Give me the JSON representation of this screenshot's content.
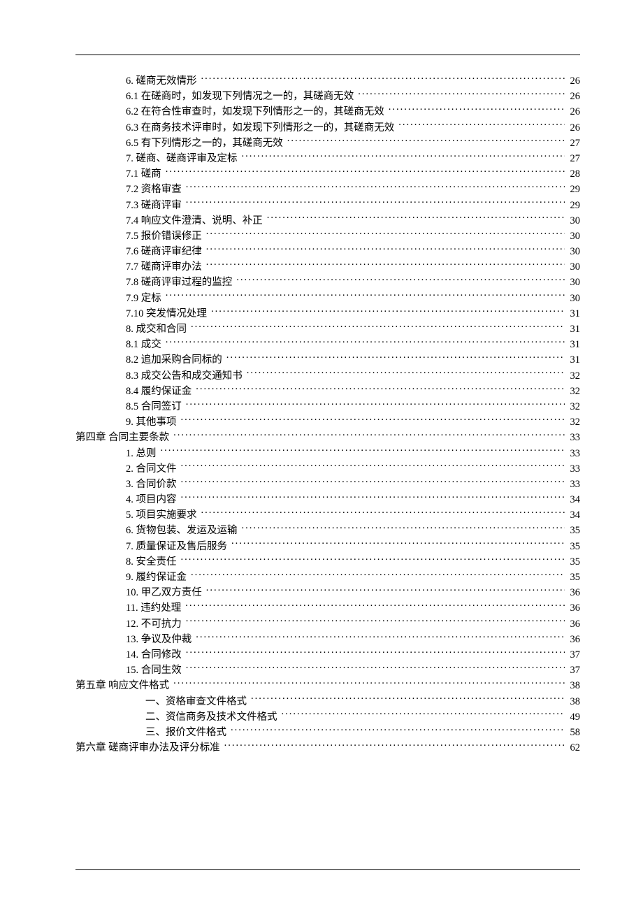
{
  "toc": [
    {
      "indent": 1,
      "label": "6. 磋商无效情形",
      "page": "26"
    },
    {
      "indent": 1,
      "label": "6.1 在磋商时，如发现下列情况之一的，其磋商无效",
      "page": "26"
    },
    {
      "indent": 1,
      "label": "6.2 在符合性审查时，如发现下列情形之一的，其磋商无效",
      "page": "26"
    },
    {
      "indent": 1,
      "label": "6.3 在商务技术评审时，如发现下列情形之一的，其磋商无效",
      "page": "26"
    },
    {
      "indent": 1,
      "label": "6.5 有下列情形之一的，其磋商无效",
      "page": "27"
    },
    {
      "indent": 1,
      "label": "7. 磋商、磋商评审及定标",
      "page": "27"
    },
    {
      "indent": 1,
      "label": "7.1 磋商",
      "page": "28"
    },
    {
      "indent": 1,
      "label": "7.2 资格审查",
      "page": "29"
    },
    {
      "indent": 1,
      "label": "7.3 磋商评审",
      "page": "29"
    },
    {
      "indent": 1,
      "label": "7.4 响应文件澄清、说明、补正",
      "page": "30"
    },
    {
      "indent": 1,
      "label": "7.5 报价错误修正",
      "page": "30"
    },
    {
      "indent": 1,
      "label": "7.6 磋商评审纪律",
      "page": "30"
    },
    {
      "indent": 1,
      "label": "7.7 磋商评审办法",
      "page": "30"
    },
    {
      "indent": 1,
      "label": "7.8 磋商评审过程的监控",
      "page": "30"
    },
    {
      "indent": 1,
      "label": "7.9 定标",
      "page": "30"
    },
    {
      "indent": 1,
      "label": "7.10 突发情况处理",
      "page": "31"
    },
    {
      "indent": 1,
      "label": "8. 成交和合同",
      "page": "31"
    },
    {
      "indent": 1,
      "label": "8.1 成交",
      "page": "31"
    },
    {
      "indent": 1,
      "label": "8.2 追加采购合同标的",
      "page": "31"
    },
    {
      "indent": 1,
      "label": "8.3 成交公告和成交通知书",
      "page": "32"
    },
    {
      "indent": 1,
      "label": "8.4 履约保证金",
      "page": "32"
    },
    {
      "indent": 1,
      "label": "8.5 合同签订",
      "page": "32"
    },
    {
      "indent": 1,
      "label": "9. 其他事项",
      "page": "32"
    },
    {
      "indent": 0,
      "label": "第四章  合同主要条款",
      "page": "33"
    },
    {
      "indent": 1,
      "label": "1. 总则",
      "page": "33"
    },
    {
      "indent": 1,
      "label": "2. 合同文件",
      "page": "33"
    },
    {
      "indent": 1,
      "label": "3. 合同价款",
      "page": "33"
    },
    {
      "indent": 1,
      "label": "4. 项目内容",
      "page": "34"
    },
    {
      "indent": 1,
      "label": "5. 项目实施要求",
      "page": "34"
    },
    {
      "indent": 1,
      "label": "6. 货物包装、发运及运输",
      "page": "35"
    },
    {
      "indent": 1,
      "label": "7. 质量保证及售后服务",
      "page": "35"
    },
    {
      "indent": 1,
      "label": "8. 安全责任",
      "page": "35"
    },
    {
      "indent": 1,
      "label": "9. 履约保证金",
      "page": "35"
    },
    {
      "indent": 1,
      "label": "10. 甲乙双方责任",
      "page": "36"
    },
    {
      "indent": 1,
      "label": "11. 违约处理",
      "page": "36"
    },
    {
      "indent": 1,
      "label": "12. 不可抗力",
      "page": "36"
    },
    {
      "indent": 1,
      "label": "13. 争议及仲裁",
      "page": "36"
    },
    {
      "indent": 1,
      "label": "14. 合同修改",
      "page": "37"
    },
    {
      "indent": 1,
      "label": "15. 合同生效",
      "page": "37"
    },
    {
      "indent": 0,
      "label": "第五章  响应文件格式",
      "page": "38"
    },
    {
      "indent": 2,
      "label": "一、资格审查文件格式",
      "page": "38"
    },
    {
      "indent": 2,
      "label": "二、资信商务及技术文件格式",
      "page": "49"
    },
    {
      "indent": 2,
      "label": "三、报价文件格式",
      "page": "58"
    },
    {
      "indent": 0,
      "label": "第六章  磋商评审办法及评分标准",
      "page": "62"
    }
  ]
}
